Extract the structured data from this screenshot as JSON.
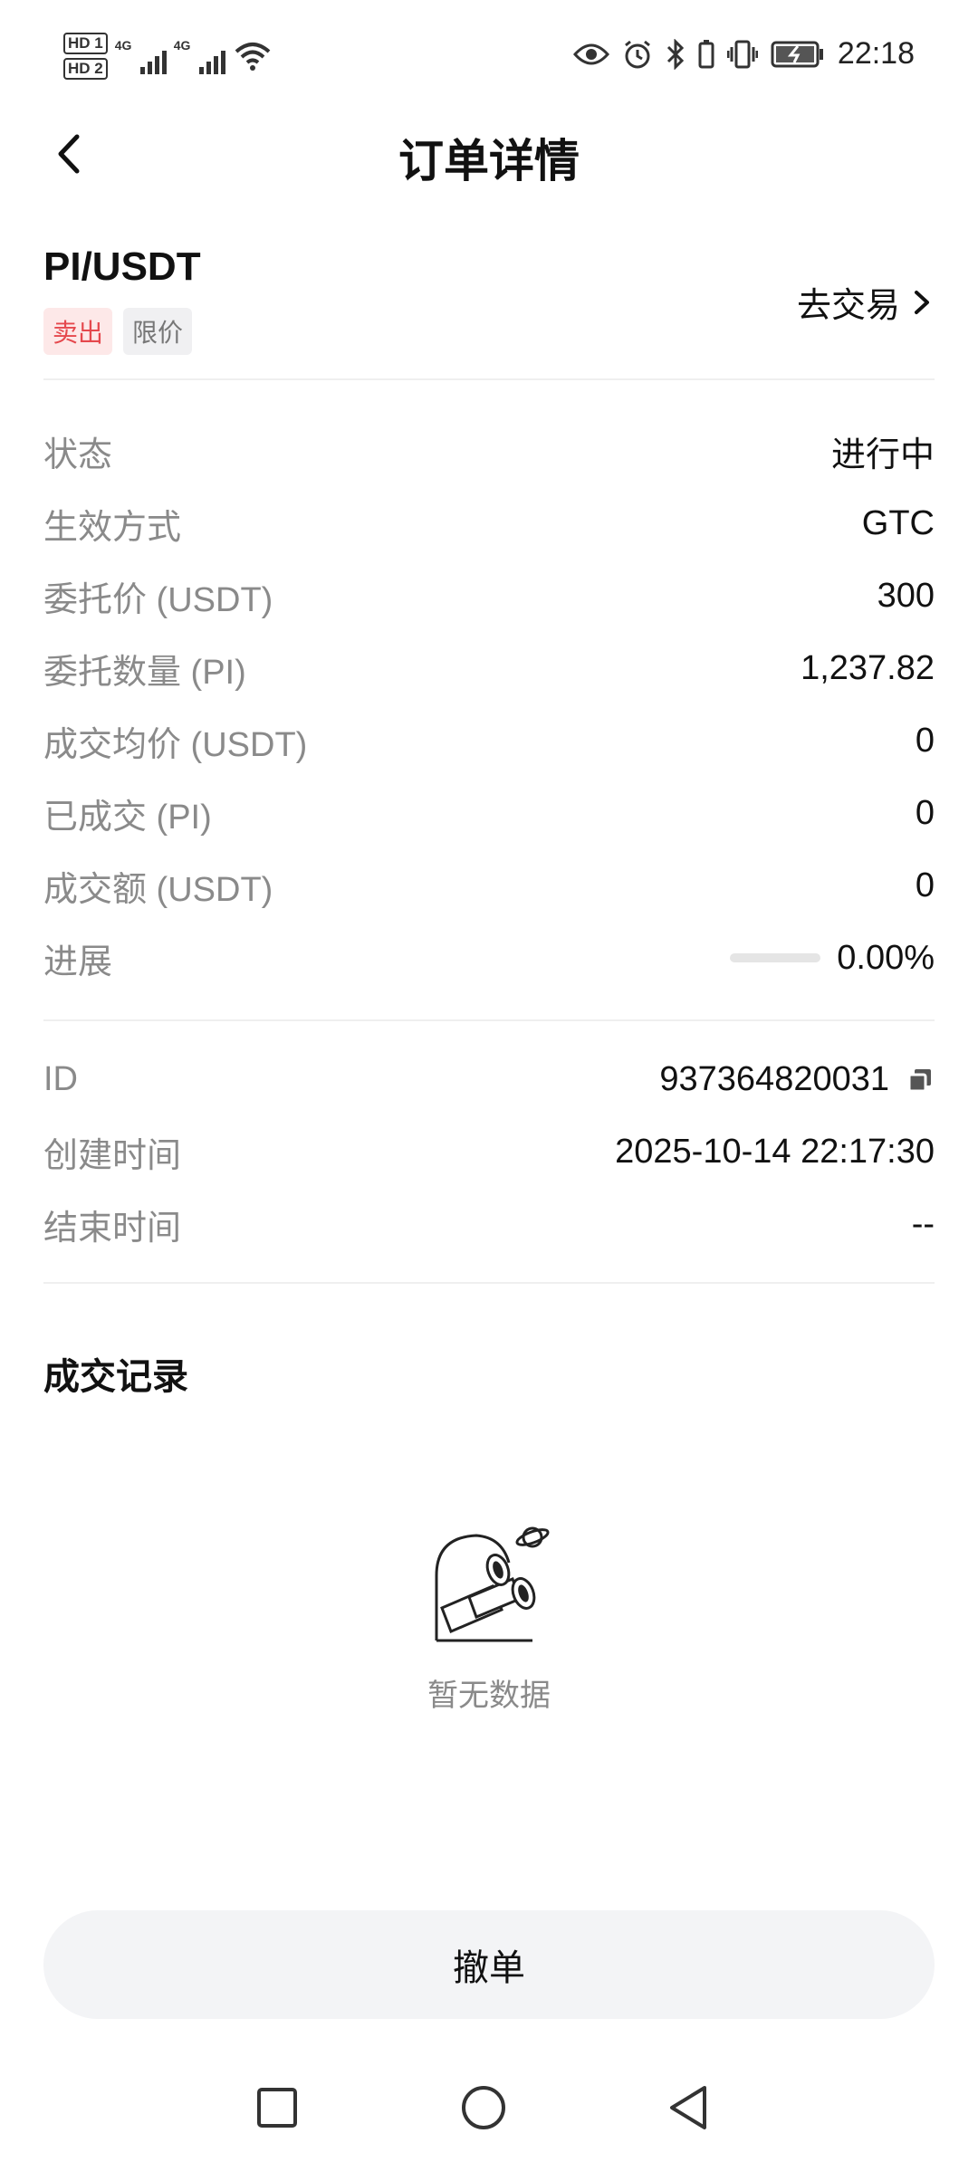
{
  "status_bar": {
    "sim1": "HD 1",
    "sim2": "HD 2",
    "net1": "4G",
    "net2": "4G",
    "time": "22:18"
  },
  "header": {
    "title": "订单详情"
  },
  "order": {
    "pair": "PI/USDT",
    "side_tag": "卖出",
    "type_tag": "限价",
    "trade_link": "去交易"
  },
  "details": [
    {
      "label": "状态",
      "value": "进行中"
    },
    {
      "label": "生效方式",
      "value": "GTC"
    },
    {
      "label": "委托价 (USDT)",
      "value": "300"
    },
    {
      "label": "委托数量 (PI)",
      "value": "1,237.82"
    },
    {
      "label": "成交均价 (USDT)",
      "value": "0"
    },
    {
      "label": "已成交 (PI)",
      "value": "0"
    },
    {
      "label": "成交额 (USDT)",
      "value": "0"
    }
  ],
  "progress": {
    "label": "进展",
    "value": "0.00%",
    "fraction": 0
  },
  "meta": [
    {
      "label": "ID",
      "value": "937364820031"
    },
    {
      "label": "创建时间",
      "value": "2025-10-14 22:17:30"
    },
    {
      "label": "结束时间",
      "value": "--"
    }
  ],
  "trades": {
    "title": "成交记录",
    "empty_text": "暂无数据"
  },
  "actions": {
    "cancel_label": "撤单"
  },
  "colors": {
    "sell": "#e5484d",
    "sell_bg": "#fde8e8",
    "muted": "#8a8a8a",
    "button_bg": "#f3f4f6"
  }
}
